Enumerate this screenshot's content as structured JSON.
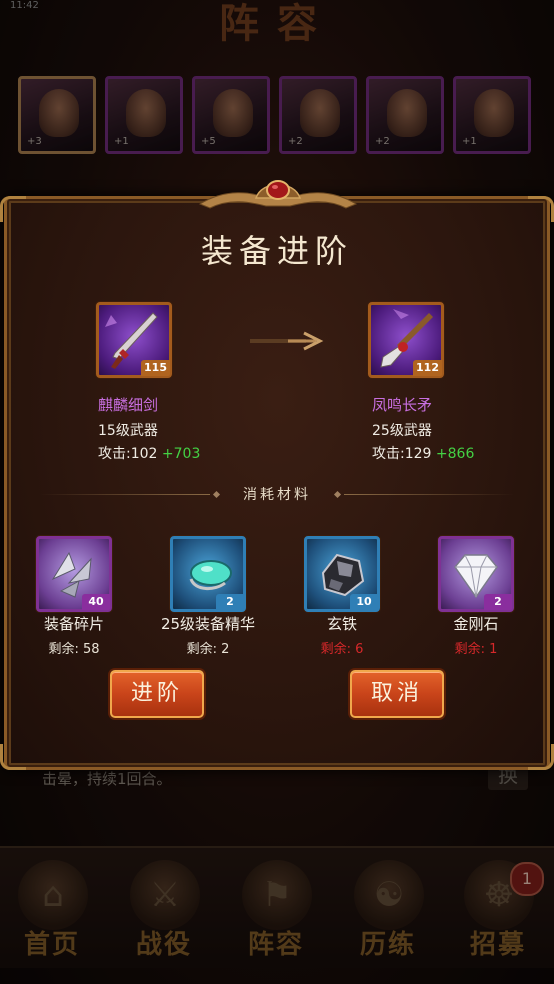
{
  "status_bar": {
    "left": "11:42",
    "right": ""
  },
  "background": {
    "title": "阵容",
    "heroes": [
      "+3",
      "+1",
      "+5",
      "+2",
      "+2",
      "+1"
    ],
    "skill_text": "击晕，持续1回合。",
    "swap_label": "换",
    "nav": [
      {
        "label": "首页",
        "icon": "palace-icon"
      },
      {
        "label": "战役",
        "icon": "crossed-swords-icon"
      },
      {
        "label": "阵容",
        "icon": "banner-icon"
      },
      {
        "label": "历练",
        "icon": "yin-yang-icon"
      },
      {
        "label": "招募",
        "icon": "recruit-icon"
      }
    ],
    "nav_badge": "1"
  },
  "dialog": {
    "title": "装备进阶",
    "from_item": {
      "level": "115",
      "name": "麒麟细剑",
      "type": "15级武器",
      "attack_label": "攻击:102",
      "attack_bonus": "+703"
    },
    "to_item": {
      "level": "112",
      "name": "凤鸣长矛",
      "type": "25级武器",
      "attack_label": "攻击:129",
      "attack_bonus": "+866"
    },
    "materials_label": "消耗材料",
    "materials": [
      {
        "name": "装备碎片",
        "count": "40",
        "remaining": "剩余: 58",
        "sufficient": true
      },
      {
        "name": "25级装备精华",
        "count": "2",
        "remaining": "剩余: 2",
        "sufficient": true
      },
      {
        "name": "玄铁",
        "count": "10",
        "remaining": "剩余: 6",
        "sufficient": false
      },
      {
        "name": "金刚石",
        "count": "2",
        "remaining": "剩余: 1",
        "sufficient": false
      }
    ],
    "confirm_label": "进阶",
    "cancel_label": "取消"
  },
  "colors": {
    "accent_orange": "#c9441a",
    "item_name_purple": "#c86fe0",
    "bonus_green": "#44d144",
    "lack_red": "#d6282a"
  }
}
